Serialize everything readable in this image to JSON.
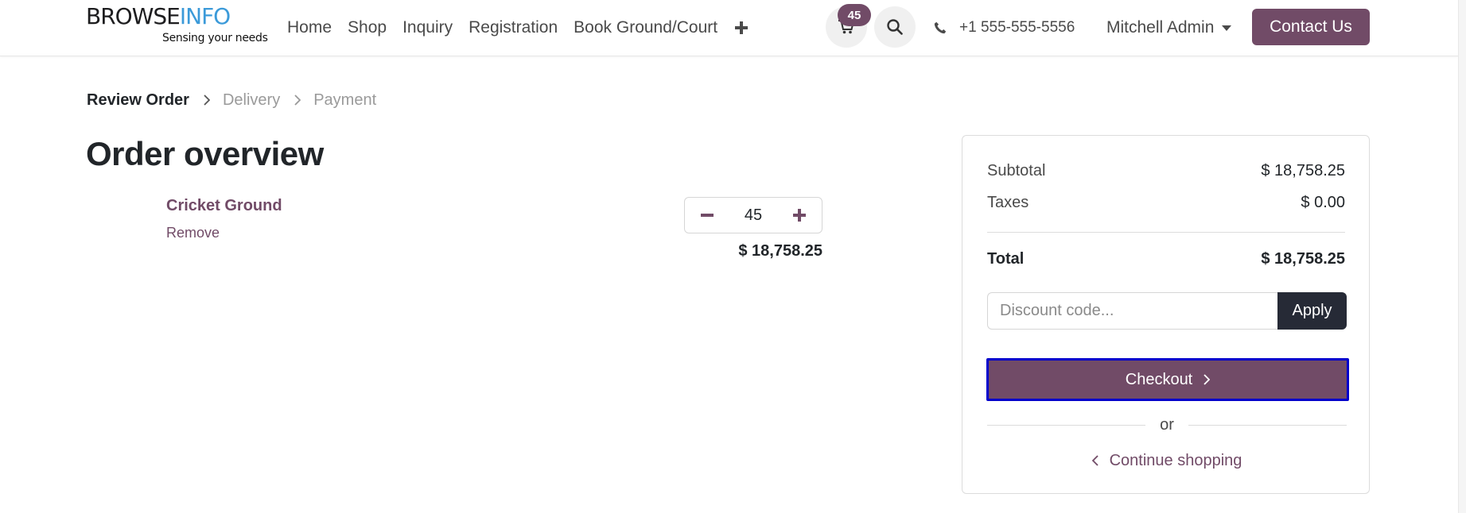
{
  "brand": {
    "name_part1": "BROWSE",
    "name_part2": "INFO",
    "tagline": "Sensing your needs"
  },
  "nav": {
    "items": [
      "Home",
      "Shop",
      "Inquiry",
      "Registration",
      "Book Ground/Court"
    ]
  },
  "header": {
    "cart_count": "45",
    "phone": "+1 555-555-5556",
    "user_name": "Mitchell Admin",
    "contact_label": "Contact Us"
  },
  "breadcrumb": {
    "steps": [
      "Review Order",
      "Delivery",
      "Payment"
    ]
  },
  "page_title": "Order overview",
  "order_line": {
    "product_name": "Cricket Ground",
    "remove_label": "Remove",
    "quantity": "45",
    "price": "$ 18,758.25"
  },
  "summary": {
    "subtotal_label": "Subtotal",
    "subtotal_value": "$ 18,758.25",
    "taxes_label": "Taxes",
    "taxes_value": "$ 0.00",
    "total_label": "Total",
    "total_value": "$ 18,758.25",
    "discount_placeholder": "Discount code...",
    "apply_label": "Apply",
    "checkout_label": "Checkout",
    "or_label": "or",
    "continue_label": "Continue shopping"
  },
  "colors": {
    "accent": "#714b67",
    "dark_button": "#262a36",
    "brand_blue": "#3b9ad9",
    "focus_outline": "#0000cc"
  },
  "icons": [
    "corner-toggle-icon",
    "plus-icon",
    "cart-icon",
    "search-icon",
    "phone-icon",
    "caret-down-icon",
    "chevron-right-icon",
    "minus-icon",
    "chevron-left-icon"
  ]
}
